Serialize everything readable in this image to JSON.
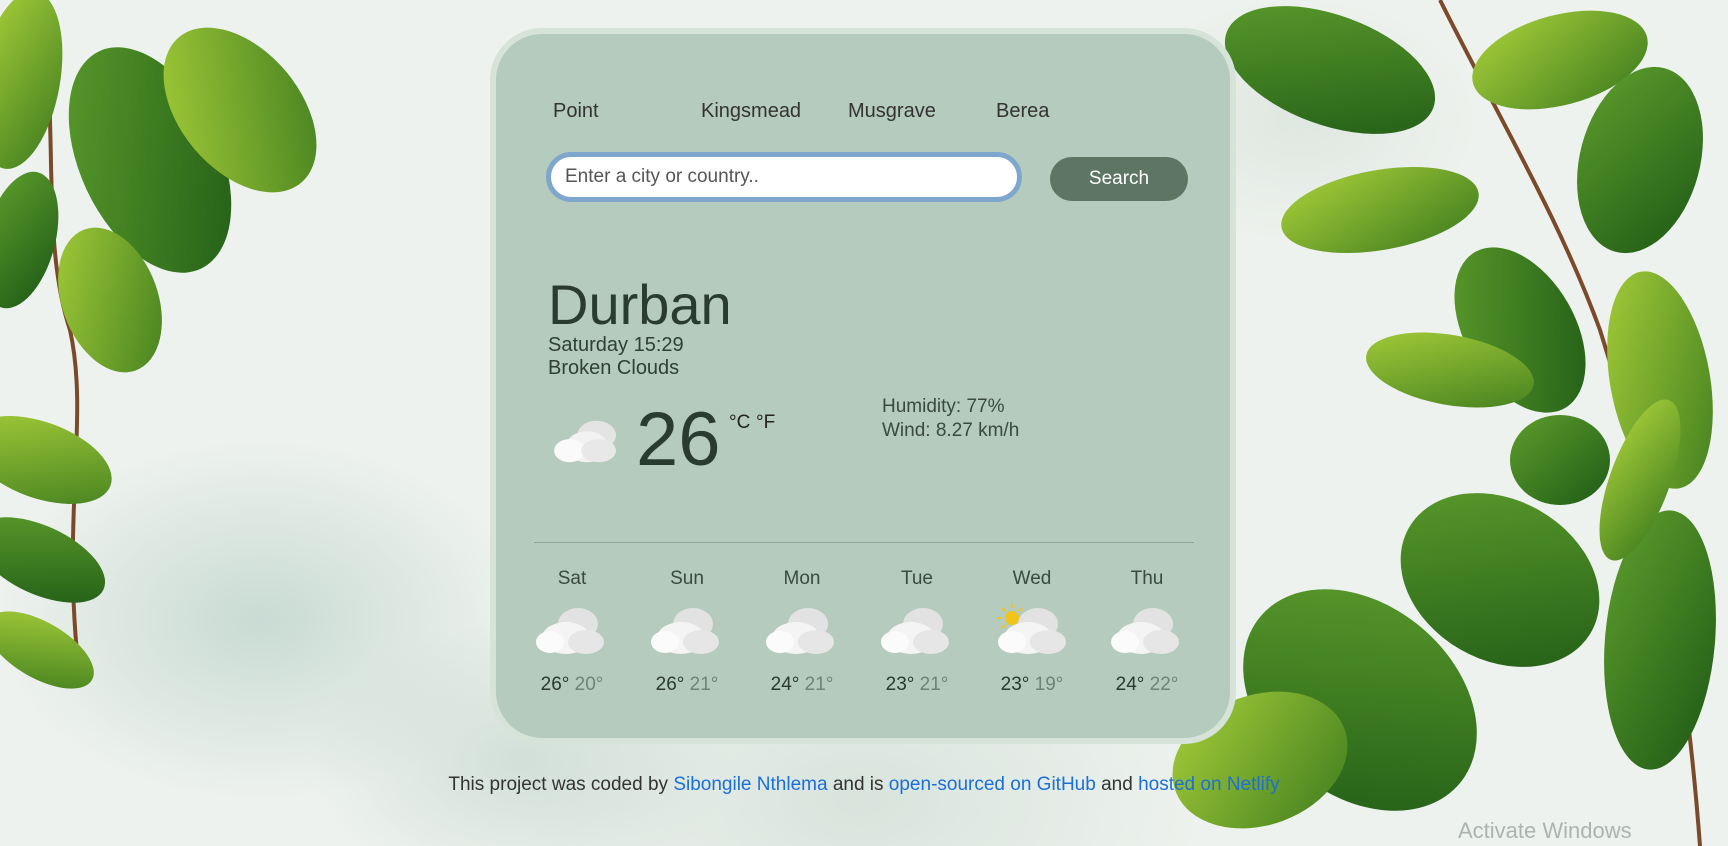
{
  "favorites": [
    "Point",
    "Kingsmead",
    "Musgrave",
    "Berea"
  ],
  "search": {
    "placeholder": "Enter a city or country..",
    "button_label": "Search"
  },
  "current": {
    "city": "Durban",
    "datetime": "Saturday 15:29",
    "description": "Broken Clouds",
    "temperature": "26",
    "unit_c": "°C",
    "unit_f": "°F",
    "humidity": "Humidity: 77%",
    "wind": "Wind: 8.27 km/h",
    "icon": "broken-clouds-icon"
  },
  "forecast": [
    {
      "day": "Sat",
      "max": "26°",
      "min": "20°",
      "icon": "cloud-icon"
    },
    {
      "day": "Sun",
      "max": "26°",
      "min": "21°",
      "icon": "cloud-icon"
    },
    {
      "day": "Mon",
      "max": "24°",
      "min": "21°",
      "icon": "cloud-icon"
    },
    {
      "day": "Tue",
      "max": "23°",
      "min": "21°",
      "icon": "cloud-icon"
    },
    {
      "day": "Wed",
      "max": "23°",
      "min": "19°",
      "icon": "sun-cloud-icon"
    },
    {
      "day": "Thu",
      "max": "24°",
      "min": "22°",
      "icon": "cloud-icon"
    }
  ],
  "footer": {
    "text_1": "This project was coded by",
    "author_link": "Sibongile Nthlema",
    "text_2": "and is",
    "github_link": "open-sourced on GitHub",
    "text_3": "and",
    "netlify_link": "hosted on Netlify"
  },
  "watermark": "Activate Windows",
  "colors": {
    "card": "#b5cbbd",
    "button": "#5f7563",
    "link": "#1a6fd8",
    "leaf": "#5c9b2e"
  }
}
